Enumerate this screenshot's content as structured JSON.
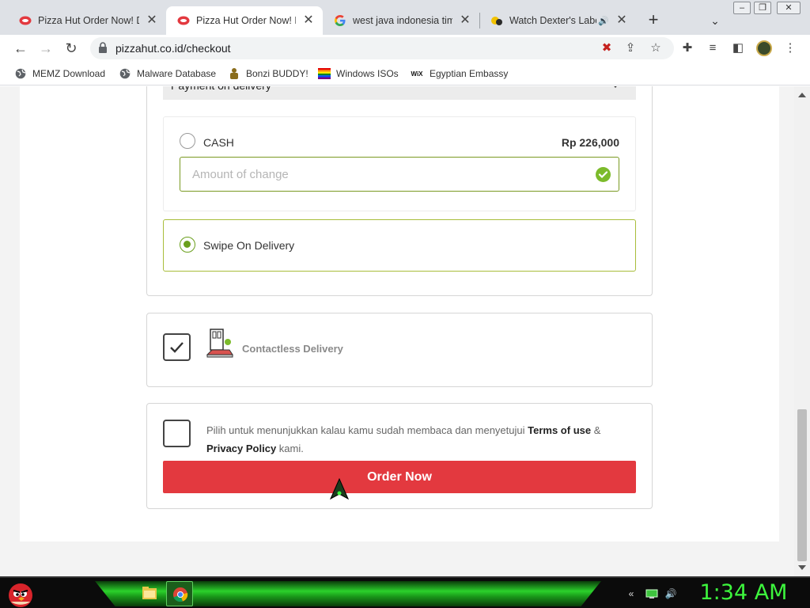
{
  "browser": {
    "tabs": [
      {
        "title": "Pizza Hut Order Now! De",
        "active": false
      },
      {
        "title": "Pizza Hut Order Now! De",
        "active": true
      },
      {
        "title": "west java indonesia time",
        "active": false
      },
      {
        "title": "Watch Dexter's Labora",
        "active": false
      }
    ],
    "url": "pizzahut.co.id/checkout",
    "bookmarks": [
      "MEMZ Download",
      "Malware Database",
      "Bonzi BUDDY!",
      "Windows ISOs",
      "Egyptian Embassy"
    ]
  },
  "checkout": {
    "payment_header": "Payment on delivery",
    "cash_label": "CASH",
    "cash_amount": "Rp 226,000",
    "change_placeholder": "Amount of change",
    "swipe_label": "Swipe On Delivery",
    "contactless_label": "Contactless Delivery",
    "terms_prefix": "Pilih untuk menunjukkan kalau kamu sudah membaca dan menyetujui",
    "terms_link": "Terms of use",
    "terms_amp": "&",
    "privacy_link": "Privacy Policy",
    "terms_suffix": "kami.",
    "order_button": "Order Now"
  },
  "taskbar": {
    "clock": "1:34 AM"
  },
  "colors": {
    "accent_red": "#e3393f",
    "accent_green": "#6a9f1c",
    "clock_green": "#3df53d"
  }
}
